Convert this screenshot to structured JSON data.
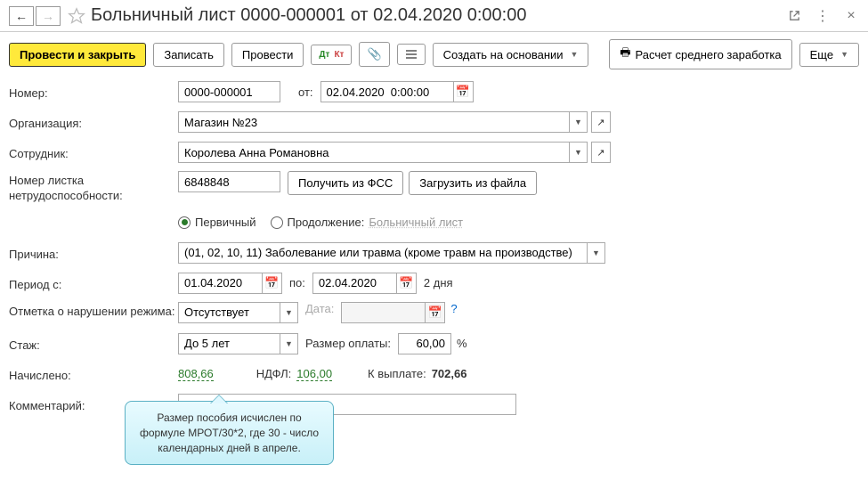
{
  "titlebar": {
    "title": "Больничный лист 0000-000001 от 02.04.2020 0:00:00"
  },
  "toolbar": {
    "post_close": "Провести и закрыть",
    "save": "Записать",
    "post": "Провести",
    "create_based": "Создать на основании",
    "avg_salary": "Расчет среднего заработка",
    "more": "Еще"
  },
  "fields": {
    "number_label": "Номер:",
    "number": "0000-000001",
    "from_label": "от:",
    "date": "02.04.2020  0:00:00",
    "org_label": "Организация:",
    "org": "Магазин №23",
    "emp_label": "Сотрудник:",
    "emp": "Королева Анна Романовна",
    "sheet_no_label": "Номер листка нетрудоспособности:",
    "sheet_no": "6848848",
    "get_fss": "Получить из ФСС",
    "load_file": "Загрузить из файла",
    "radio_primary": "Первичный",
    "radio_continue": "Продолжение:",
    "radio_continue_link": "Больничный лист",
    "reason_label": "Причина:",
    "reason": "(01, 02, 10, 11) Заболевание или травма (кроме травм на производстве)",
    "period_label": "Период с:",
    "period_from": "01.04.2020",
    "period_to_label": "по:",
    "period_to": "02.04.2020",
    "period_days": "2 дня",
    "violation_label": "Отметка о нарушении режима:",
    "violation": "Отсутствует",
    "violation_date_label": "Дата:",
    "exp_label": "Стаж:",
    "exp": "До 5 лет",
    "pay_rate_label": "Размер оплаты:",
    "pay_rate": "60,00",
    "pay_rate_pct": "%",
    "accrued_label": "Начислено:",
    "accrued": "808,66",
    "ndfl_label": "НДФЛ:",
    "ndfl": "106,00",
    "to_pay_label": "К выплате:",
    "to_pay": "702,66",
    "comment_label": "Комментарий:"
  },
  "callout": "Размер пособия исчислен по формуле МРОТ/30*2, где 30 - число календарных дней в апреле."
}
